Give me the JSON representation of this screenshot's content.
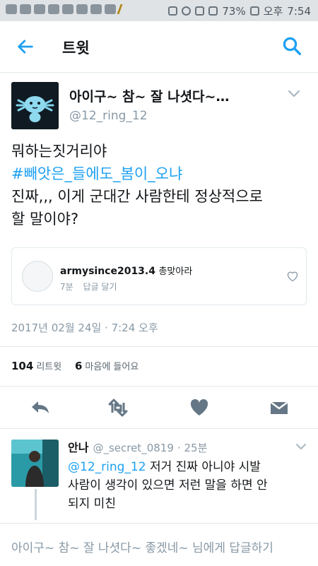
{
  "statusbar": {
    "battery": "73%",
    "ampm": "오후",
    "time": "7:54"
  },
  "header": {
    "title": "트윗"
  },
  "tweet": {
    "author_name": "아이구~ 참~ 잘 나셧다~…",
    "author_handle": "@12_ring_12",
    "line1": "뭐하는짓거리야",
    "hashtag": "#빼앗은_들에도_봄이_오냐",
    "line3": "진짜,,, 이게 군대간 사람한테 정상적으로",
    "line4": "할 말이야?",
    "timestamp": "2017년 02월 24일 · 7:24 오후"
  },
  "quoted": {
    "user": "armysince2013.4",
    "user_extra": "총맞아라",
    "time": "7분",
    "reply_label": "답글 달기"
  },
  "stats": {
    "retweets_count": "104",
    "retweets_label": "리트윗",
    "likes_count": "6",
    "likes_label": "마음에 들어요"
  },
  "reply": {
    "name": "안나",
    "handle": "@_secret_0819",
    "time": "· 25분",
    "mention": "@12_ring_12",
    "text_after_mention": " 저거 진짜 아니야 시발",
    "line2": "사람이 생각이 있으면 저런 말을 하면 안",
    "line3": "되지 미친"
  },
  "composer": {
    "placeholder": "아이구~ 참~ 잘 나셧다~ 좋겠네~ 님에게 답글하기"
  },
  "colors": {
    "accent": "#1da1f2",
    "muted": "#8899a6",
    "icon": "#657786"
  }
}
